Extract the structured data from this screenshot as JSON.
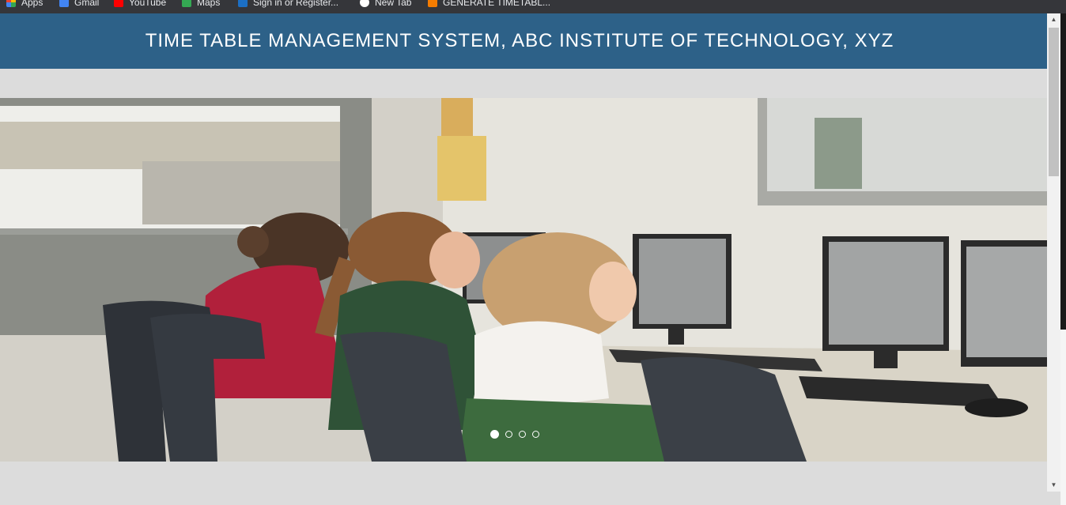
{
  "bookmarks": [
    {
      "label": "Apps",
      "color": "#fbbc04"
    },
    {
      "label": "Gmail",
      "color": "#4285f4"
    },
    {
      "label": "YouTube",
      "color": "#ff0000"
    },
    {
      "label": "Maps",
      "color": "#34a853"
    },
    {
      "label": "Sign in or Register...",
      "color": "#1c6fc4"
    },
    {
      "label": "New Tab",
      "color": "#ffffff"
    },
    {
      "label": "GENERATE TIMETABL...",
      "color": "#f57c00"
    }
  ],
  "header": {
    "title": "TIME TABLE MANAGEMENT SYSTEM, ABC INSTITUTE OF TECHNOLOGY, XYZ",
    "background": "#2d6188"
  },
  "carousel": {
    "slide_count": 4,
    "active_index": 0
  }
}
